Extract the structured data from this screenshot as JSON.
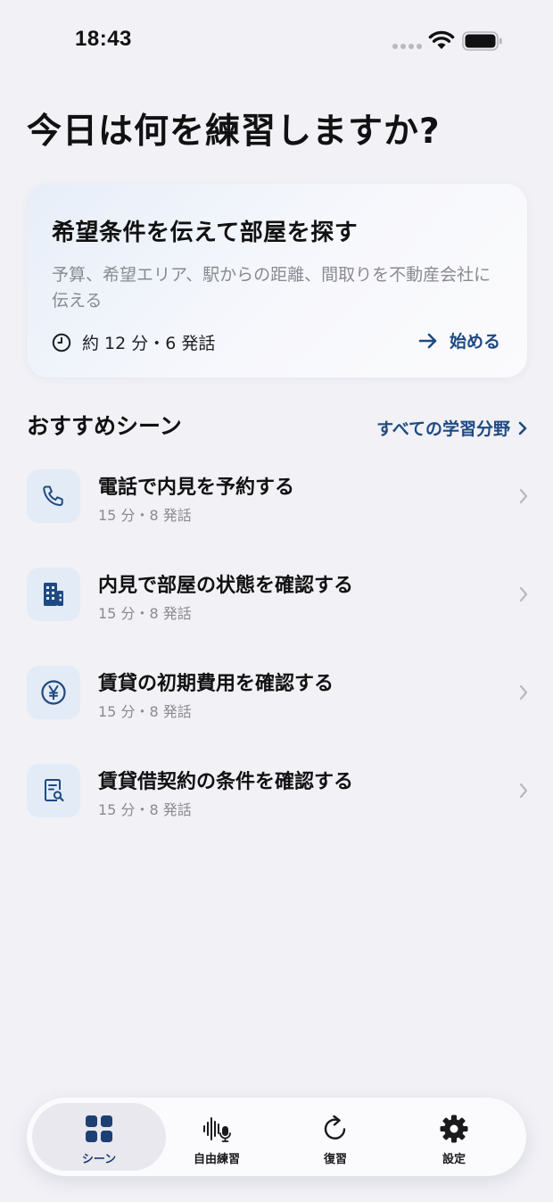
{
  "status_bar": {
    "time": "18:43"
  },
  "header": {
    "title": "今日は何を練習しますか?"
  },
  "featured": {
    "title": "希望条件を伝えて部屋を探す",
    "description": "予算、希望エリア、駅からの距離、間取りを不動産会社に伝える",
    "meta": "約 12 分・6 発話",
    "start_label": "始める"
  },
  "section": {
    "title": "おすすめシーン",
    "see_all_label": "すべての学習分野"
  },
  "scenes": [
    {
      "icon": "phone-icon",
      "title": "電話で内見を予約する",
      "meta": "15 分・8 発話"
    },
    {
      "icon": "building-icon",
      "title": "内見で部屋の状態を確認する",
      "meta": "15 分・8 発話"
    },
    {
      "icon": "yen-icon",
      "title": "賃貸の初期費用を確認する",
      "meta": "15 分・8 発話"
    },
    {
      "icon": "contract-search-icon",
      "title": "賃貸借契約の条件を確認する",
      "meta": "15 分・8 発話"
    }
  ],
  "tab_bar": {
    "active": "scene",
    "items": [
      {
        "icon": "grid-icon",
        "label": "シーン"
      },
      {
        "icon": "voice-mic-icon",
        "label": "自由練習"
      },
      {
        "icon": "refresh-icon",
        "label": "復習"
      },
      {
        "icon": "gear-icon",
        "label": "設定"
      }
    ]
  },
  "colors": {
    "background": "#f1f1f6",
    "accent": "#1e4a82",
    "icon_tile": "#e3ebf6",
    "muted_text": "#8a8a90"
  }
}
